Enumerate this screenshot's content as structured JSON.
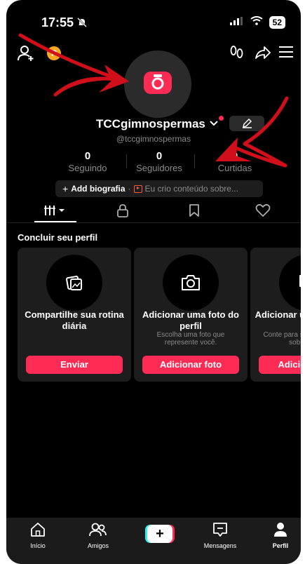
{
  "status_bar": {
    "time": "17:55",
    "battery": "52"
  },
  "top_bar": {
    "coin_label": "P"
  },
  "profile": {
    "username": "TCCgimnospermas",
    "handle": "@tccgimnospermas"
  },
  "stats": [
    {
      "value": "0",
      "label": "Seguindo"
    },
    {
      "value": "0",
      "label": "Seguidores"
    },
    {
      "value": "0",
      "label": "Curtidas"
    }
  ],
  "bio": {
    "add_label": "Add biografia",
    "separator": "·",
    "content_prompt": "Eu crio conteúdo sobre..."
  },
  "sections": {
    "complete_profile_title": "Concluir seu perfil"
  },
  "cards": [
    {
      "title": "Compartilhe sua rotina diária",
      "desc": "",
      "button": "Enviar"
    },
    {
      "title": "Adicionar uma foto do perfil",
      "desc": "Escolha uma foto que represente você.",
      "button": "Adicionar foto"
    },
    {
      "title": "Adicionar uma biografia",
      "desc": "Conte para seus seguidores sobre você.",
      "button": "Adicionar bio"
    }
  ],
  "bottom_nav": {
    "home": "Início",
    "friends": "Amigos",
    "create": "+",
    "messages": "Mensagens",
    "profile": "Perfil"
  },
  "colors": {
    "accent": "#fe2c55",
    "background": "#000000",
    "card": "#1d1d1d",
    "annotation_arrow": "#d10f1a"
  }
}
